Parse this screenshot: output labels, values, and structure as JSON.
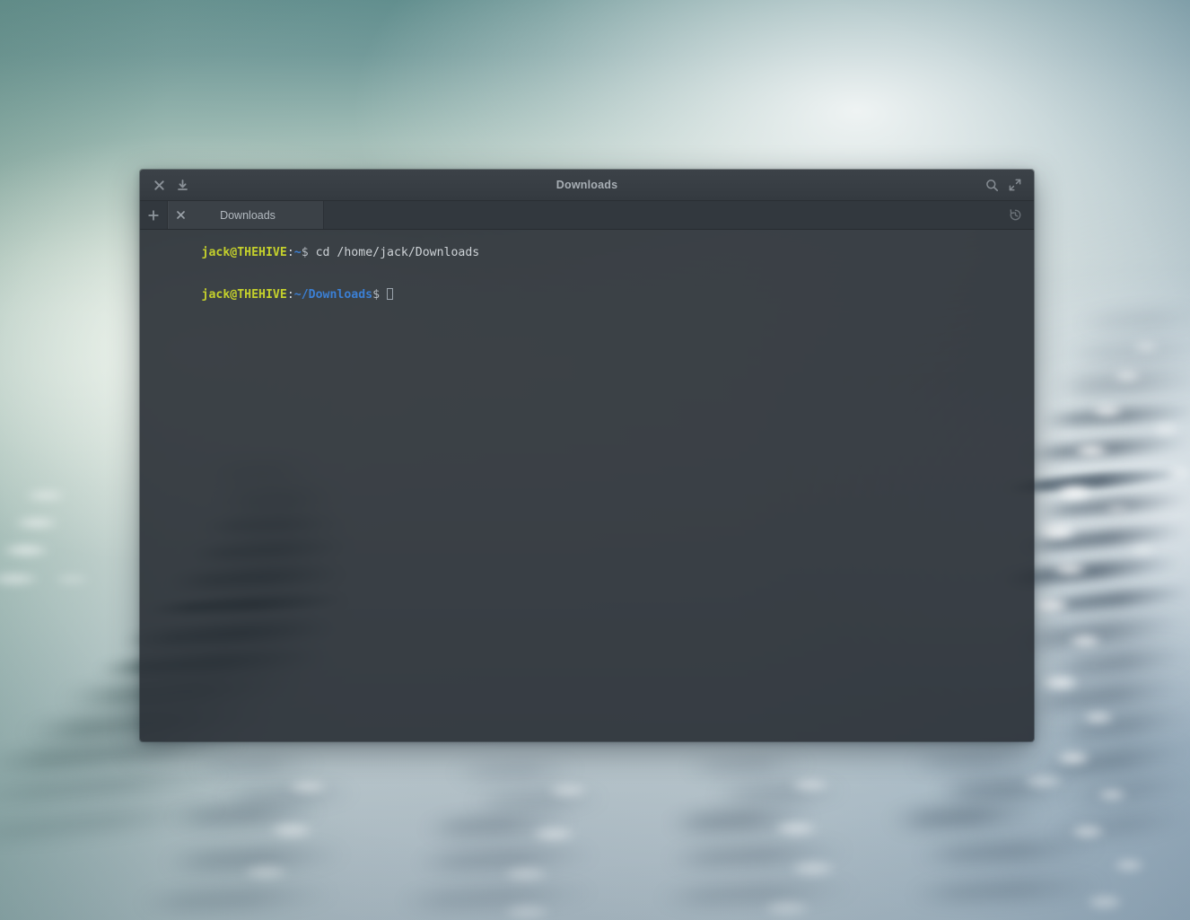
{
  "desktop": {
    "wallpaper_description": "blurred macro photograph of a computer keyboard, teal-green to blue-grey gradient",
    "colors": {
      "wallpaper_top": "#5d8b8b",
      "wallpaper_mid": "#edf1e9",
      "wallpaper_bottom": "#a2b2bc",
      "window_titlebar": "#383e44",
      "window_tabbar": "#32383e",
      "window_tab_active": "#3b4147",
      "terminal_background": "#2f353b",
      "prompt_user": "#c4d02c",
      "prompt_path": "#3b7fd4",
      "terminal_text": "#cfd3d6"
    }
  },
  "window": {
    "title": "Downloads",
    "titlebar_left_buttons": [
      {
        "name": "close-icon",
        "label": "Close"
      },
      {
        "name": "download-icon",
        "label": "Download"
      }
    ],
    "titlebar_right_buttons": [
      {
        "name": "search-icon",
        "label": "Search"
      },
      {
        "name": "maximize-icon",
        "label": "Maximize"
      }
    ]
  },
  "tabbar": {
    "new_tab_label": "+",
    "history_label": "History",
    "tabs": [
      {
        "label": "Downloads",
        "close_label": "×",
        "active": true
      }
    ]
  },
  "terminal": {
    "lines": [
      {
        "user": "jack@THEHIVE",
        "colon": ":",
        "path": "~",
        "dollar": "$",
        "command": " cd /home/jack/Downloads"
      },
      {
        "user": "jack@THEHIVE",
        "colon": ":",
        "path": "~/Downloads",
        "dollar": "$",
        "command": " "
      }
    ]
  }
}
